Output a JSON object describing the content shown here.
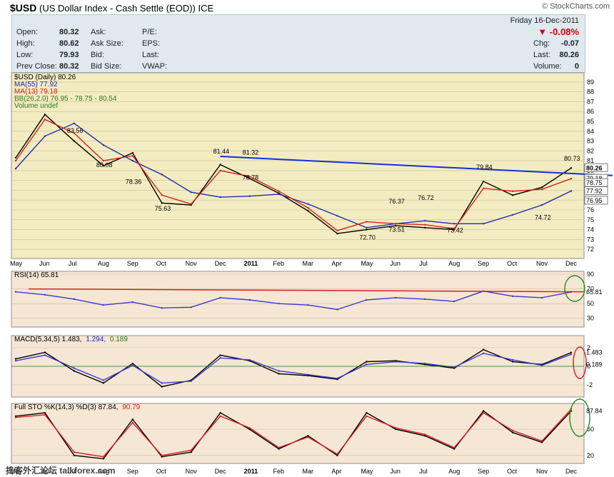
{
  "header": {
    "symbol": "$USD",
    "description": "(US Dollar Index - Cash Settle (EOD))",
    "exchange": "ICE",
    "brand": "© StockCharts.com"
  },
  "quote": {
    "open_label": "Open:",
    "open": "80.32",
    "high_label": "High:",
    "high": "80.62",
    "low_label": "Low:",
    "low": "79.93",
    "prev_label": "Prev Close:",
    "prev": "80.32",
    "ask_label": "Ask:",
    "asksize_label": "Ask Size:",
    "bid_label": "Bid:",
    "bidsize_label": "Bid Size:",
    "pe_label": "P/E:",
    "eps_label": "EPS:",
    "last2_label": "Last:",
    "vwap_label": "VWAP:",
    "date": "Friday  16-Dec-2011",
    "change_pct": "-0.08%",
    "chg_label": "Chg:",
    "chg": "-0.07",
    "last_label": "Last:",
    "last": "80.26",
    "volume_label": "Volume:",
    "volume": "0"
  },
  "price_legend": [
    "$USD (Daily) 80.26",
    "MA(55) 77.92",
    "MA(13) 79.18",
    "BB(26,2.0) 76.95 - 78.75 - 80.54",
    "Volume undef"
  ],
  "rsi_label": "RSI(14) 65.81",
  "macd_label_a": "MACD(5,34,5) 1.483,",
  "macd_label_b": "1.294,",
  "macd_label_c": "0.189",
  "sto_label_a": "Full STO %K(14,3) %D(3) 87.84,",
  "sto_label_b": "90.79",
  "footer": "捣客外汇论坛 talkforex.com",
  "colors": {
    "price_bg": "#f3ecc0",
    "ind_bg": "#f6e6d4",
    "price": "#000000",
    "ma55": "#1f2ab5",
    "ma13": "#d62020",
    "bb": "#2a7a20",
    "trend": "#1030e0"
  },
  "chart_data": [
    {
      "type": "line",
      "title": "$USD (Daily) 80.26",
      "x": [
        "May",
        "Jun",
        "Jul",
        "Aug",
        "Sep",
        "Oct",
        "Nov",
        "Dec",
        "2011",
        "Feb",
        "Mar",
        "Apr",
        "May",
        "Jun",
        "Jul",
        "Aug",
        "Sep",
        "Oct",
        "Nov",
        "Dec"
      ],
      "ylim": [
        71.5,
        89.5
      ],
      "yticks": [
        72,
        73,
        74,
        75,
        76,
        77,
        78,
        79,
        80,
        81,
        82,
        83,
        84,
        85,
        86,
        87,
        88,
        89
      ],
      "series": [
        {
          "name": "$USD (Daily) 80.26",
          "values": [
            81.3,
            85.7,
            83.0,
            80.5,
            81.8,
            76.7,
            76.5,
            80.6,
            79.2,
            77.7,
            75.9,
            73.6,
            74.0,
            74.4,
            74.2,
            74.0,
            78.9,
            77.5,
            78.3,
            80.26
          ]
        },
        {
          "name": "MA(55) 77.92",
          "values": [
            80.2,
            83.5,
            84.8,
            82.6,
            81.0,
            79.6,
            77.8,
            77.3,
            77.4,
            77.6,
            76.6,
            75.4,
            74.2,
            74.6,
            74.9,
            74.6,
            74.6,
            75.5,
            76.5,
            77.92
          ]
        },
        {
          "name": "MA(13) 79.18",
          "values": [
            81.0,
            85.2,
            83.8,
            81.0,
            81.5,
            77.5,
            76.6,
            80.0,
            79.4,
            77.9,
            76.2,
            73.9,
            74.8,
            74.6,
            74.5,
            74.1,
            78.2,
            77.9,
            78.1,
            79.18
          ]
        }
      ],
      "annotations": [
        {
          "label": "83.56",
          "value": 83.56
        },
        {
          "label": "80.08",
          "value": 80.08
        },
        {
          "label": "78.36",
          "value": 78.36
        },
        {
          "label": "75.63",
          "value": 75.63
        },
        {
          "label": "81.44",
          "value": 81.44
        },
        {
          "label": "81.32",
          "value": 81.32
        },
        {
          "label": "78.78",
          "value": 78.78
        },
        {
          "label": "76.37",
          "value": 76.37
        },
        {
          "label": "72.70",
          "value": 72.7
        },
        {
          "label": "73.51",
          "value": 73.51
        },
        {
          "label": "76.72",
          "value": 76.72
        },
        {
          "label": "73.42",
          "value": 73.42
        },
        {
          "label": "79.84",
          "value": 79.84
        },
        {
          "label": "74.72",
          "value": 74.72
        },
        {
          "label": "80.73",
          "value": 80.73
        }
      ],
      "right_labels": [
        "80.26",
        "79.18",
        "78.75",
        "77.92",
        "76.95"
      ]
    },
    {
      "type": "line",
      "title": "RSI(14) 65.81",
      "ylim": [
        20,
        90
      ],
      "yticks": [
        30,
        50,
        70,
        90
      ],
      "series": [
        {
          "name": "RSI(14) 65.81",
          "values": [
            66,
            62,
            56,
            48,
            52,
            44,
            45,
            58,
            55,
            50,
            48,
            42,
            55,
            58,
            56,
            53,
            67,
            60,
            58,
            65.81
          ]
        }
      ],
      "right_labels": [
        "65.81"
      ]
    },
    {
      "type": "line",
      "title": "MACD(5,34,5) 1.483, 1.294, 0.189",
      "ylim": [
        -3,
        3
      ],
      "yticks": [
        -2,
        0,
        2
      ],
      "series": [
        {
          "name": "MACD",
          "values": [
            0.8,
            1.5,
            -0.5,
            -1.8,
            0.3,
            -2.2,
            -1.5,
            1.2,
            0.6,
            -0.8,
            -1.0,
            -1.4,
            0.5,
            0.6,
            0.2,
            -0.2,
            1.8,
            0.5,
            0.2,
            1.483
          ]
        },
        {
          "name": "Signal",
          "values": [
            0.6,
            1.2,
            -0.2,
            -1.5,
            0.1,
            -1.8,
            -1.6,
            0.9,
            0.7,
            -0.5,
            -0.9,
            -1.3,
            0.2,
            0.5,
            0.3,
            -0.1,
            1.4,
            0.7,
            0.1,
            1.294
          ]
        }
      ],
      "right_labels": [
        "1.483",
        "0.189"
      ]
    },
    {
      "type": "line",
      "title": "Full STO %K(14,3) %D(3) 87.84, 90.79",
      "ylim": [
        10,
        95
      ],
      "yticks": [
        20,
        60
      ],
      "series": [
        {
          "name": "%K",
          "values": [
            80,
            85,
            20,
            15,
            75,
            18,
            25,
            85,
            60,
            30,
            50,
            20,
            85,
            60,
            50,
            30,
            88,
            55,
            40,
            87.84
          ]
        },
        {
          "name": "%D",
          "values": [
            78,
            82,
            25,
            18,
            70,
            20,
            28,
            80,
            62,
            32,
            48,
            22,
            80,
            62,
            52,
            32,
            85,
            58,
            42,
            90.79
          ]
        }
      ],
      "right_labels": [
        "87.84"
      ]
    }
  ]
}
